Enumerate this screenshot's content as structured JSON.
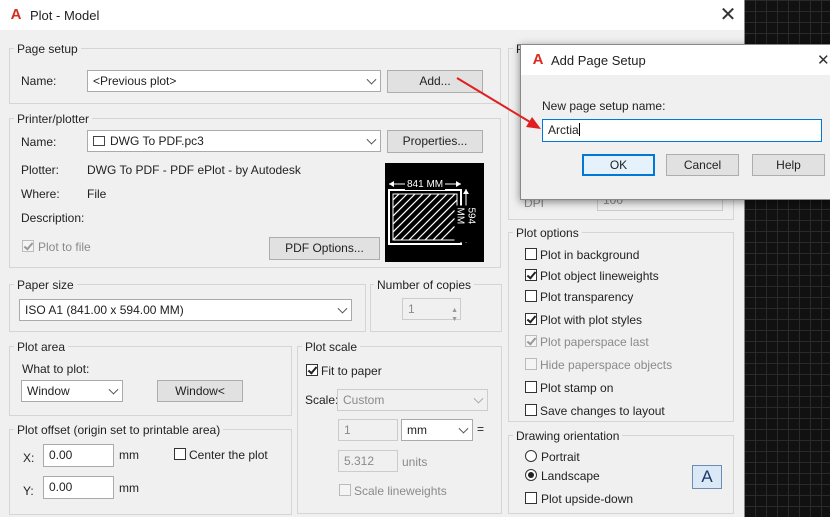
{
  "window": {
    "title": "Plot - Model",
    "close_glyph": "✕"
  },
  "page_setup": {
    "group": "Page setup",
    "name_label": "Name:",
    "name_value": "<Previous plot>",
    "add_button": "Add..."
  },
  "printer": {
    "group": "Printer/plotter",
    "name_label": "Name:",
    "name_value": "DWG To PDF.pc3",
    "properties_button": "Properties...",
    "plotter_label": "Plotter:",
    "plotter_value": "DWG To PDF - PDF ePlot - by Autodesk",
    "where_label": "Where:",
    "where_value": "File",
    "description_label": "Description:",
    "plot_to_file": "Plot to file",
    "pdf_options_button": "PDF Options...",
    "preview_width": "841 MM",
    "preview_height": "594 MM"
  },
  "paper_size": {
    "group": "Paper size",
    "value": "ISO A1 (841.00 x 594.00 MM)"
  },
  "copies": {
    "group": "Number of copies",
    "value": "1"
  },
  "plot_area": {
    "group": "Plot area",
    "what_label": "What to plot:",
    "what_value": "Window",
    "window_button": "Window<"
  },
  "plot_offset": {
    "group": "Plot offset (origin set to printable area)",
    "x_label": "X:",
    "x_value": "0.00",
    "x_unit": "mm",
    "y_label": "Y:",
    "y_value": "0.00",
    "y_unit": "mm",
    "center_label": "Center the plot"
  },
  "plot_scale": {
    "group": "Plot scale",
    "fit_label": "Fit to paper",
    "scale_label": "Scale:",
    "scale_value": "Custom",
    "num_value": "1",
    "unit_value": "mm",
    "equals": "=",
    "units_value": "5.312",
    "units_label": "units",
    "lineweights_label": "Scale lineweights"
  },
  "plot_style": {
    "group_partial": "P",
    "dpi_label": "DPI",
    "dpi_value": "100"
  },
  "plot_options": {
    "group": "Plot options",
    "items": [
      {
        "label": "Plot in background",
        "checked": false,
        "enabled": true
      },
      {
        "label": "Plot object lineweights",
        "checked": true,
        "enabled": true
      },
      {
        "label": "Plot transparency",
        "checked": false,
        "enabled": true
      },
      {
        "label": "Plot with plot styles",
        "checked": true,
        "enabled": true
      },
      {
        "label": "Plot paperspace last",
        "checked": true,
        "enabled": false
      },
      {
        "label": "Hide paperspace objects",
        "checked": false,
        "enabled": false
      },
      {
        "label": "Plot stamp on",
        "checked": false,
        "enabled": true
      },
      {
        "label": "Save changes to layout",
        "checked": false,
        "enabled": true
      }
    ]
  },
  "orientation": {
    "group": "Drawing orientation",
    "portrait": "Portrait",
    "landscape": "Landscape",
    "upside_down": "Plot upside-down",
    "selected": "Landscape",
    "icon_letter": "A"
  },
  "add_dialog": {
    "title": "Add Page Setup",
    "prompt": "New page setup name:",
    "value": "Arctia",
    "ok": "OK",
    "cancel": "Cancel",
    "help": "Help",
    "close_glyph": "✕"
  },
  "annotation_color": "#e02020",
  "logo_letter": "A"
}
